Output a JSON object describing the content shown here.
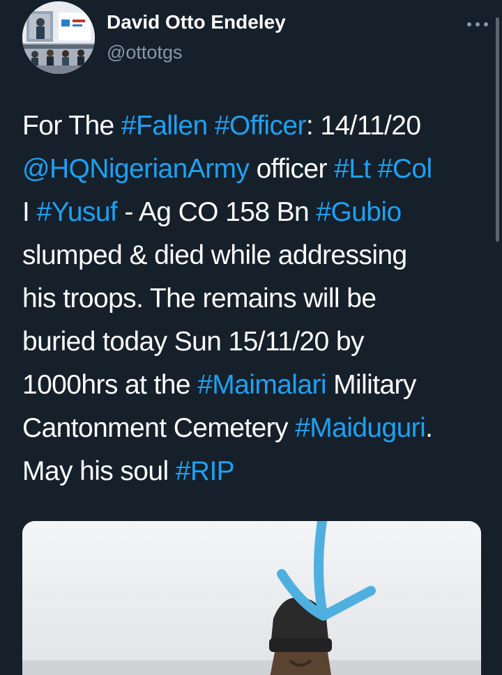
{
  "author": {
    "display_name": "David Otto Endeley",
    "handle": "@ottotgs",
    "avatar_icon": "profile-photo-conference"
  },
  "more_icon": "more-horizontal-icon",
  "tweet": {
    "lines": [
      [
        {
          "t": "For The ",
          "k": "text"
        },
        {
          "t": "#Fallen",
          "k": "hashtag"
        },
        {
          "t": " ",
          "k": "text"
        },
        {
          "t": "#Officer",
          "k": "hashtag"
        },
        {
          "t": ": 14/11/20",
          "k": "text"
        }
      ],
      [
        {
          "t": "@HQNigerianArmy",
          "k": "mention"
        },
        {
          "t": " officer ",
          "k": "text"
        },
        {
          "t": "#Lt",
          "k": "hashtag"
        },
        {
          "t": " ",
          "k": "text"
        },
        {
          "t": "#Col",
          "k": "hashtag"
        }
      ],
      [
        {
          "t": "I ",
          "k": "text"
        },
        {
          "t": "#Yusuf",
          "k": "hashtag"
        },
        {
          "t": " - Ag CO 158 Bn ",
          "k": "text"
        },
        {
          "t": "#Gubio",
          "k": "hashtag"
        }
      ],
      [
        {
          "t": "slumped & died while addressing",
          "k": "text"
        }
      ],
      [
        {
          "t": "his troops. The remains will be",
          "k": "text"
        }
      ],
      [
        {
          "t": "buried today Sun 15/11/20 by",
          "k": "text"
        }
      ],
      [
        {
          "t": "1000hrs at the ",
          "k": "text"
        },
        {
          "t": "#Maimalari",
          "k": "hashtag"
        },
        {
          "t": " Military",
          "k": "text"
        }
      ],
      [
        {
          "t": "Cantonment Cemetery ",
          "k": "text"
        },
        {
          "t": "#Maiduguri",
          "k": "hashtag"
        },
        {
          "t": ".",
          "k": "text"
        }
      ],
      [
        {
          "t": "May his soul ",
          "k": "text"
        },
        {
          "t": "#RIP",
          "k": "hashtag"
        }
      ]
    ]
  },
  "media": {
    "description_icon": "attached-photo",
    "annotation_color": "#4fb0e0"
  },
  "colors": {
    "background": "#15202b",
    "text": "#ffffff",
    "link": "#1da1f2",
    "secondary": "#8899a6"
  }
}
